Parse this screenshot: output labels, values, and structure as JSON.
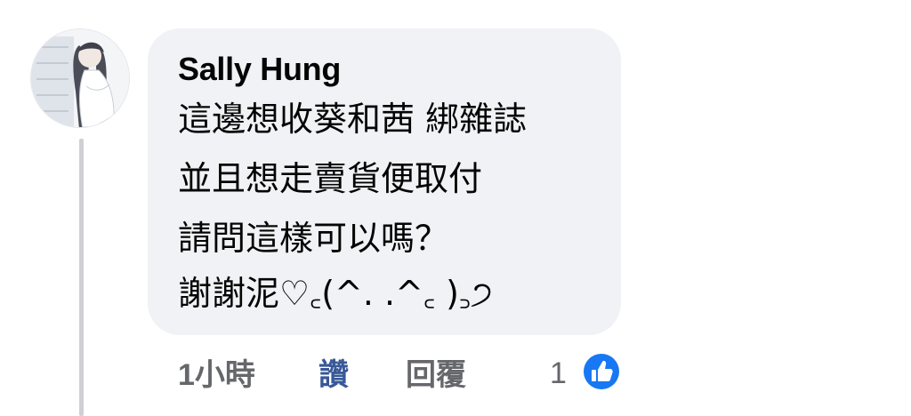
{
  "comment": {
    "author": "Sally Hung",
    "lines": [
      "這邊想收葵和茜 綁雜誌",
      "並且想走賣貨便取付",
      "請問這樣可以嗎？",
      "謝謝泥♡꜀(^. .^꜀ )꜆੭"
    ]
  },
  "actions": {
    "timestamp": "1小時",
    "like_label": "讚",
    "reply_label": "回覆",
    "reaction_count": "1"
  },
  "icons": {
    "avatar": "avatar-illustration",
    "reaction": "like-thumb-icon"
  },
  "colors": {
    "bubble_bg": "#f0f2f5",
    "like_blue": "#1877f2",
    "link_blue": "#385898",
    "meta_gray": "#65676b"
  }
}
